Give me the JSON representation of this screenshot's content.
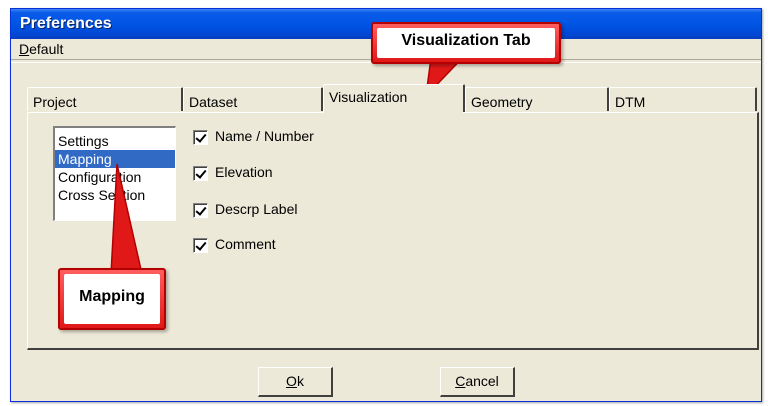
{
  "window": {
    "title": "Preferences"
  },
  "menu": {
    "default_first": "D",
    "default_rest": "efault"
  },
  "tabs": [
    {
      "label": "Project"
    },
    {
      "label": "Dataset"
    },
    {
      "label": "Visualization"
    },
    {
      "label": "Geometry"
    },
    {
      "label": "DTM"
    }
  ],
  "active_tab": "Visualization",
  "list": {
    "items": [
      "Settings",
      "Mapping",
      "Configuration",
      "Cross Section"
    ],
    "selected": "Mapping"
  },
  "checkboxes": [
    {
      "label": "Name / Number",
      "checked": true
    },
    {
      "label": "Elevation",
      "checked": true
    },
    {
      "label": "Descrp Label",
      "checked": true
    },
    {
      "label": "Comment",
      "checked": true
    }
  ],
  "buttons": {
    "ok_first": "O",
    "ok_rest": "k",
    "cancel_first": "C",
    "cancel_rest": "ancel"
  },
  "callouts": {
    "visualization": "Visualization Tab",
    "mapping": "Mapping"
  },
  "colors": {
    "titlebar": "#0055e5",
    "selection": "#316ac5",
    "callout_red": "#e01818"
  }
}
